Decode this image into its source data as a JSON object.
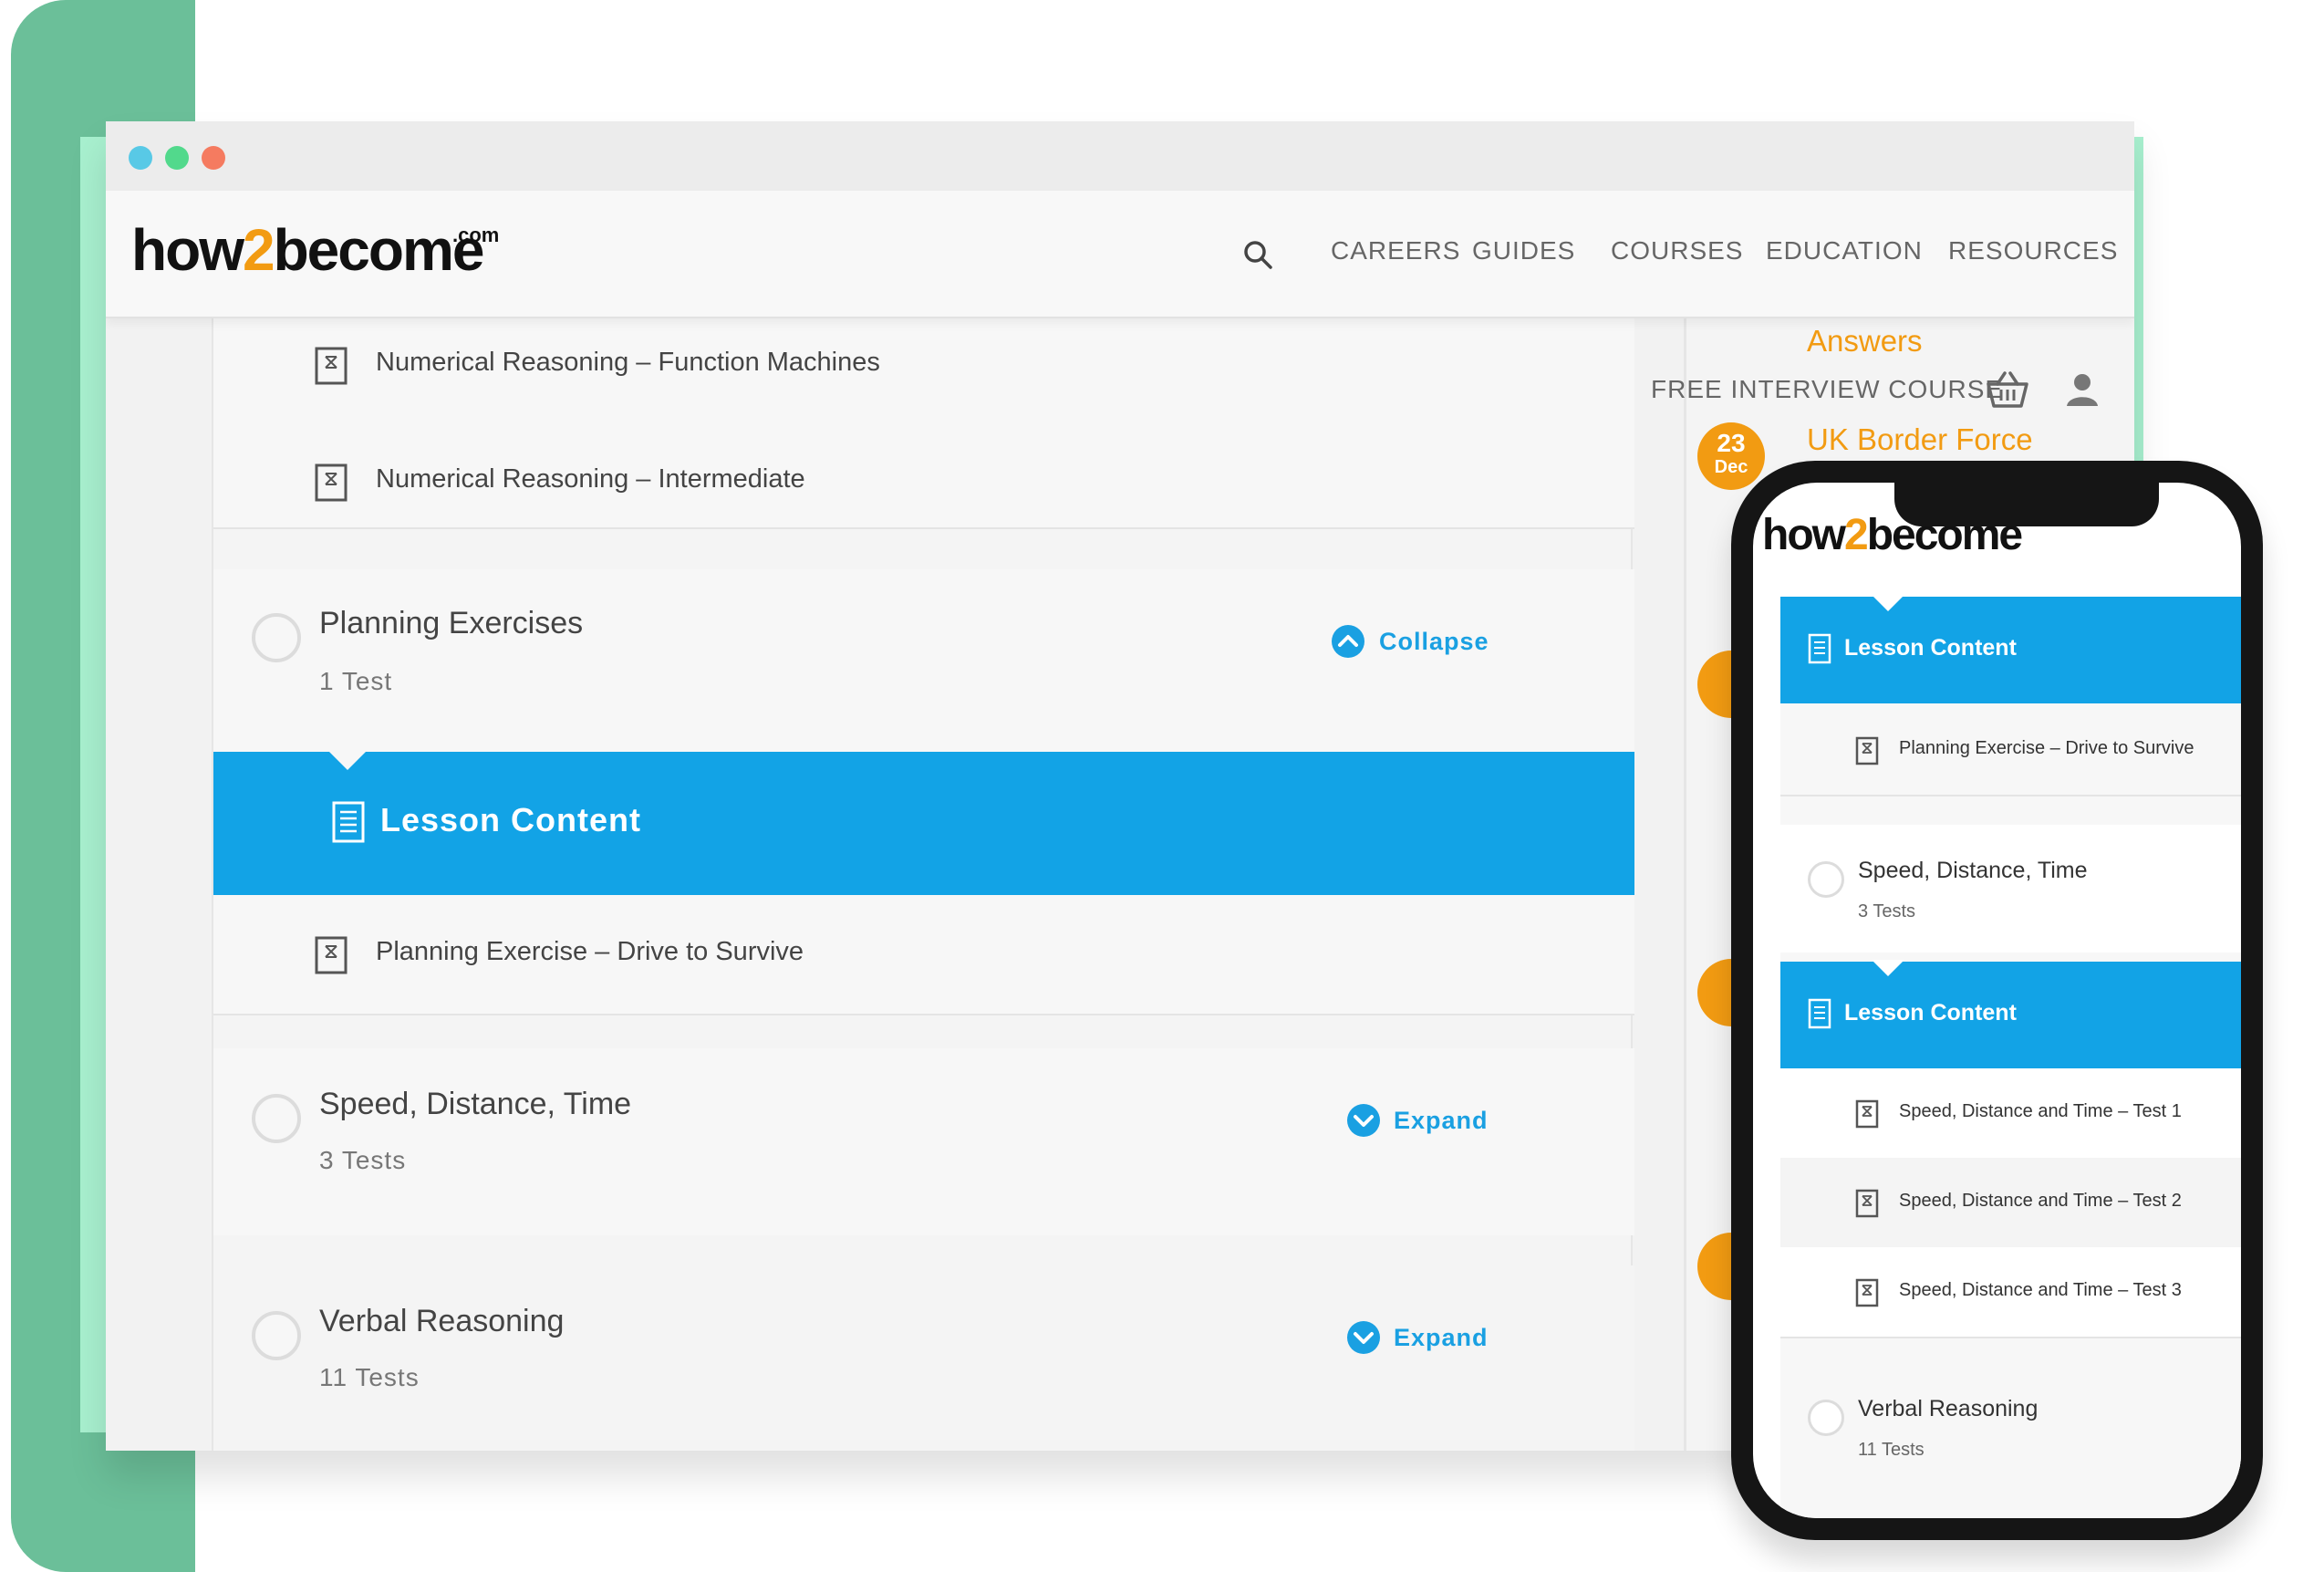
{
  "site": {
    "logo_main": "how",
    "logo_two": "2",
    "logo_rest": "become",
    "logo_com": ".com"
  },
  "nav": {
    "items": [
      "CAREERS",
      "GUIDES",
      "COURSES",
      "EDUCATION",
      "RESOURCES"
    ]
  },
  "main": {
    "tests_top": [
      "Numerical Reasoning – Function Machines",
      "Numerical Reasoning – Intermediate"
    ],
    "sections": [
      {
        "title": "Planning Exercises",
        "subtitle": "1 Test",
        "toggle": "Collapse"
      },
      {
        "title": "Speed, Distance, Time",
        "subtitle": "3 Tests",
        "toggle": "Expand"
      },
      {
        "title": "Verbal Reasoning",
        "subtitle": "11 Tests",
        "toggle": "Expand"
      }
    ],
    "lesson_content_label": "Lesson Content",
    "planning_test": "Planning Exercise – Drive to Survive"
  },
  "sidebar": {
    "answers_text": "Answers",
    "free_course": "FREE INTERVIEW COURSE",
    "badge1_day": "23",
    "badge1_month": "Dec",
    "badge1_title": "UK Border Force"
  },
  "phone": {
    "lesson_label": "Lesson Content",
    "planning_test": "Planning Exercise – Drive to Survive",
    "speed_title": "Speed, Distance, Time",
    "speed_sub": "3 Tests",
    "speed_tests": [
      "Speed, Distance and Time – Test 1",
      "Speed, Distance and Time – Test 2",
      "Speed, Distance and Time – Test 3"
    ],
    "verbal_title": "Verbal Reasoning",
    "verbal_sub": "11 Tests"
  },
  "colors": {
    "accent": "#12a3e6",
    "brand_orange": "#f29b12",
    "green_bar": "#6bbf99",
    "mint_frame": "#a8f0cf"
  }
}
